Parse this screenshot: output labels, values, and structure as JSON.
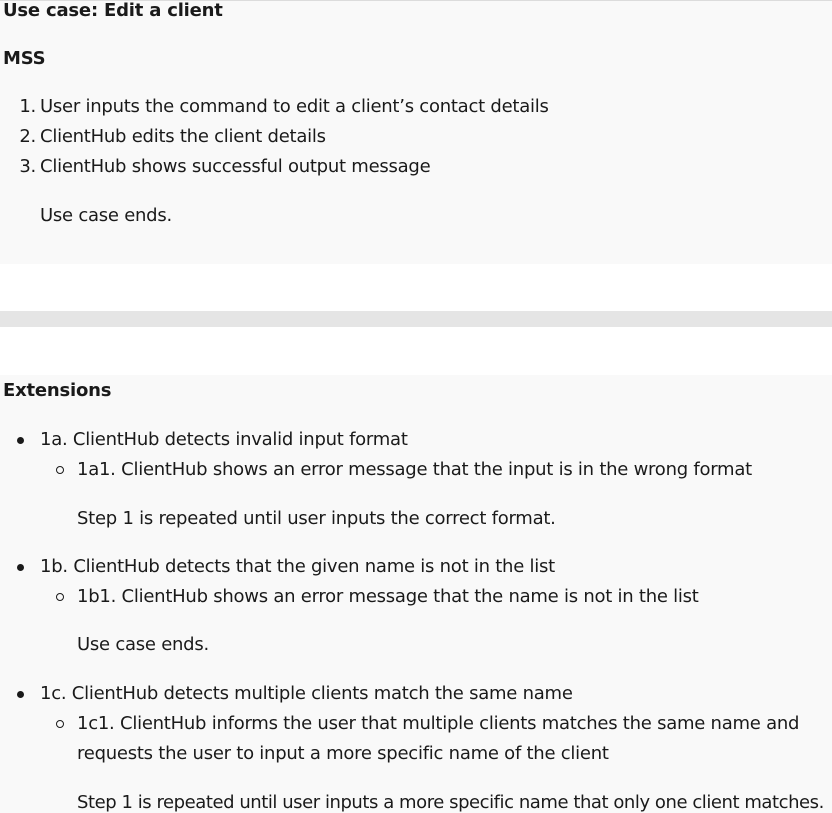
{
  "title": "Use case: Edit a client",
  "mss": {
    "heading": "MSS",
    "steps": [
      "User inputs the command to edit a client’s contact details",
      "ClientHub edits the client details",
      "ClientHub shows successful output message"
    ],
    "markers": [
      "1.",
      "2.",
      "3."
    ],
    "end_note": "Use case ends."
  },
  "extensions": {
    "heading": "Extensions",
    "items": [
      {
        "label": "1a. ClientHub detects invalid input format",
        "sub": "1a1. ClientHub shows an error message that the input is in the wrong format",
        "note": "Step 1 is repeated until user inputs the correct format."
      },
      {
        "label": "1b. ClientHub detects that the given name is not in the list",
        "sub": "1b1. ClientHub shows an error message that the name is not in the list",
        "note": "Use case ends."
      },
      {
        "label": "1c. ClientHub detects multiple clients match the same name",
        "sub_line1": "1c1. ClientHub informs the user that multiple clients matches the same name and",
        "sub_line2": "requests the user to input a more specific name of the client",
        "note": "Step 1 is repeated until user inputs a more specific name that only one client matches."
      }
    ]
  }
}
